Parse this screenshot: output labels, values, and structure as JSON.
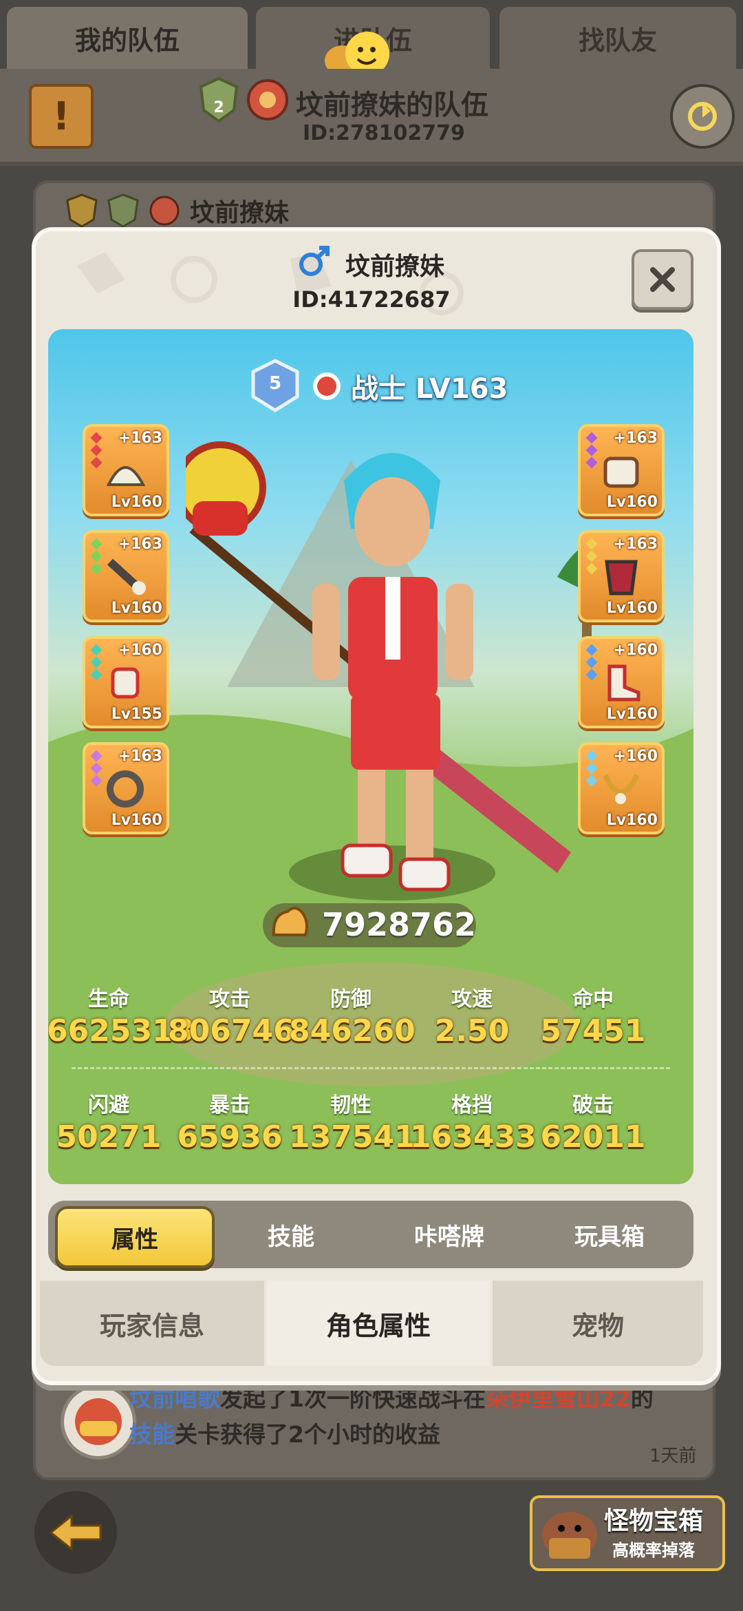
{
  "top_tabs": {
    "my_team": "我的队伍",
    "enter_team": "进队伍",
    "find_teammates": "找队友"
  },
  "chat": {
    "label": "聊天"
  },
  "team": {
    "name": "坟前撩妹的队伍",
    "id": "ID:278102779",
    "badge_level": "2"
  },
  "member_row": {
    "name": "坟前撩妹"
  },
  "profile": {
    "name": "坟前撩妹",
    "id": "ID:41722687",
    "class_label": "战士 LV163",
    "rank_badge": "5",
    "power": "7928762"
  },
  "equipment_left": [
    {
      "plus": "+163",
      "lv": "Lv160"
    },
    {
      "plus": "+163",
      "lv": "Lv160"
    },
    {
      "plus": "+160",
      "lv": "Lv155"
    },
    {
      "plus": "+163",
      "lv": "Lv160"
    }
  ],
  "equipment_right": [
    {
      "plus": "+163",
      "lv": "Lv160"
    },
    {
      "plus": "+163",
      "lv": "Lv160"
    },
    {
      "plus": "+160",
      "lv": "Lv160"
    },
    {
      "plus": "+160",
      "lv": "Lv160"
    }
  ],
  "stats_row1": [
    {
      "label": "生命",
      "value": "6625313"
    },
    {
      "label": "攻击",
      "value": "806746"
    },
    {
      "label": "防御",
      "value": "846260"
    },
    {
      "label": "攻速",
      "value": "2.50"
    },
    {
      "label": "命中",
      "value": "57451"
    }
  ],
  "stats_row2": [
    {
      "label": "闪避",
      "value": "50271"
    },
    {
      "label": "暴击",
      "value": "65936"
    },
    {
      "label": "韧性",
      "value": "137541"
    },
    {
      "label": "格挡",
      "value": "163433"
    },
    {
      "label": "破击",
      "value": "62011"
    }
  ],
  "sub_tabs": {
    "attributes": "属性",
    "skills": "技能",
    "kata_cards": "咔嗒牌",
    "toy_box": "玩具箱"
  },
  "bottom_tabs": {
    "player_info": "玩家信息",
    "character_attributes": "角色属性",
    "pets": "宠物"
  },
  "feed": {
    "actor": "坟前唱歌",
    "text1": "发起了1次一阶快速战斗在",
    "place": "朵伊里雪山22",
    "text2": "的",
    "skill": "技能",
    "text3": "关卡获得了2个小时的收益",
    "time": "1天前"
  },
  "chest": {
    "title": "怪物宝箱",
    "subtitle": "高概率掉落"
  },
  "colors": {
    "stat_value": "#ffd84a",
    "equip_orange": "#f0a043",
    "active_tab": "#f6d75a"
  }
}
